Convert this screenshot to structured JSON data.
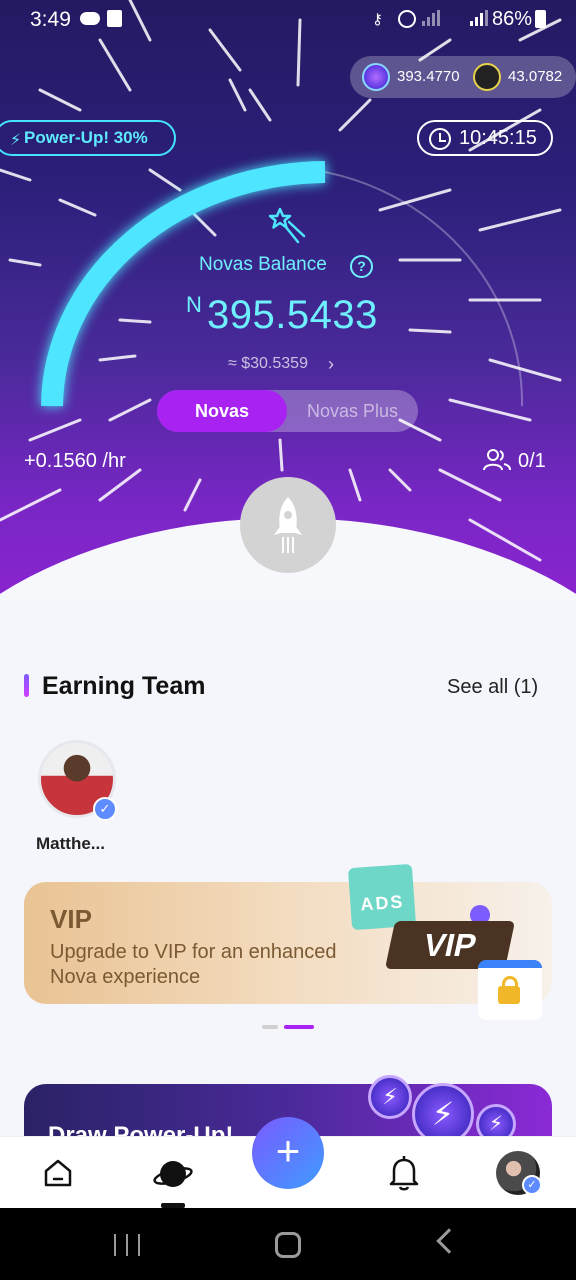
{
  "status_bar": {
    "time": "3:49",
    "battery_text": "86%"
  },
  "wallet": {
    "nova_value": "393.4770",
    "alt_value": "43.0782"
  },
  "powerup_chip": {
    "label": "Power-Up! 30%"
  },
  "timer": {
    "value": "10:45:15"
  },
  "balance": {
    "label": "Novas Balance",
    "currency_symbol": "N",
    "value": "395.5433",
    "usd": "≈ $30.5359",
    "help_glyph": "?",
    "chevron": "›"
  },
  "mode_toggle": {
    "active_label": "Novas",
    "inactive_label": "Novas Plus"
  },
  "rate": {
    "text": "+0.1560 /hr"
  },
  "team_count": {
    "text": "0/1"
  },
  "earning_team": {
    "title": "Earning Team",
    "see_all": "See all (1)",
    "members": [
      {
        "name": "Matthe..."
      }
    ]
  },
  "vip_banner": {
    "title": "VIP",
    "description": "Upgrade to VIP for an enhanced Nova experience",
    "ads_text": "ADS",
    "tag_text": "VIP"
  },
  "powerup_card": {
    "title": "Draw Power-Up!"
  },
  "bottom_nav": {
    "add_glyph": "+"
  },
  "colors": {
    "accent_cyan": "#4ee6ff",
    "accent_purple": "#a822f2",
    "hero_top": "#241a62",
    "hero_bottom": "#8a24d0"
  },
  "icons": [
    "cloud-icon",
    "message-icon",
    "key-icon",
    "alarm-icon",
    "signal-icon",
    "battery-icon",
    "nova-token-icon",
    "alt-token-icon",
    "bolt-icon",
    "clock-icon",
    "star-icon",
    "help-icon",
    "team-icon",
    "rocket-icon",
    "verified-badge-icon",
    "lock-icon",
    "home-icon",
    "explore-icon",
    "bell-icon",
    "add-icon"
  ]
}
